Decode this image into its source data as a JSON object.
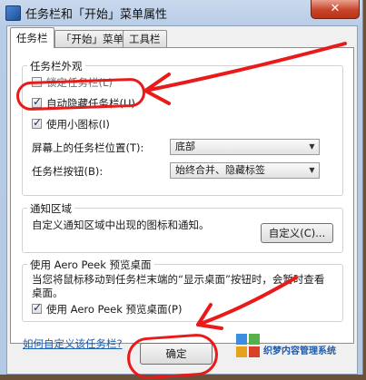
{
  "window": {
    "title": "任务栏和「开始」菜单属性",
    "close_glyph": "✕"
  },
  "tabs": [
    {
      "label": "任务栏",
      "active": true
    },
    {
      "label": "「开始」菜单",
      "active": false
    },
    {
      "label": "工具栏",
      "active": false
    }
  ],
  "appearance": {
    "title": "任务栏外观",
    "lock": {
      "label": "锁定任务栏(L)",
      "checked": false
    },
    "autohide": {
      "label": "自动隐藏任务栏(U)",
      "checked": true
    },
    "small_icons": {
      "label": "使用小图标(I)",
      "checked": true
    },
    "position": {
      "label": "屏幕上的任务栏位置(T):",
      "value": "底部"
    },
    "buttons": {
      "label": "任务栏按钮(B):",
      "value": "始终合并、隐藏标签"
    }
  },
  "notification": {
    "title": "通知区域",
    "text": "自定义通知区域中出现的图标和通知。",
    "customize_label": "自定义(C)..."
  },
  "peek": {
    "title": "使用 Aero Peek 预览桌面",
    "text": "当您将鼠标移动到任务栏末端的“显示桌面”按钮时，会暂时查看桌面。",
    "checkbox": {
      "label": "使用 Aero Peek 预览桌面(P)",
      "checked": true
    }
  },
  "help_link": "如何自定义该任务栏?",
  "ok_label": "确定",
  "check_glyph": "✓",
  "watermark": {
    "text": "织梦内容管理系统"
  },
  "colors": {
    "annotation": "#e81a1a",
    "link": "#1a5fb4"
  }
}
